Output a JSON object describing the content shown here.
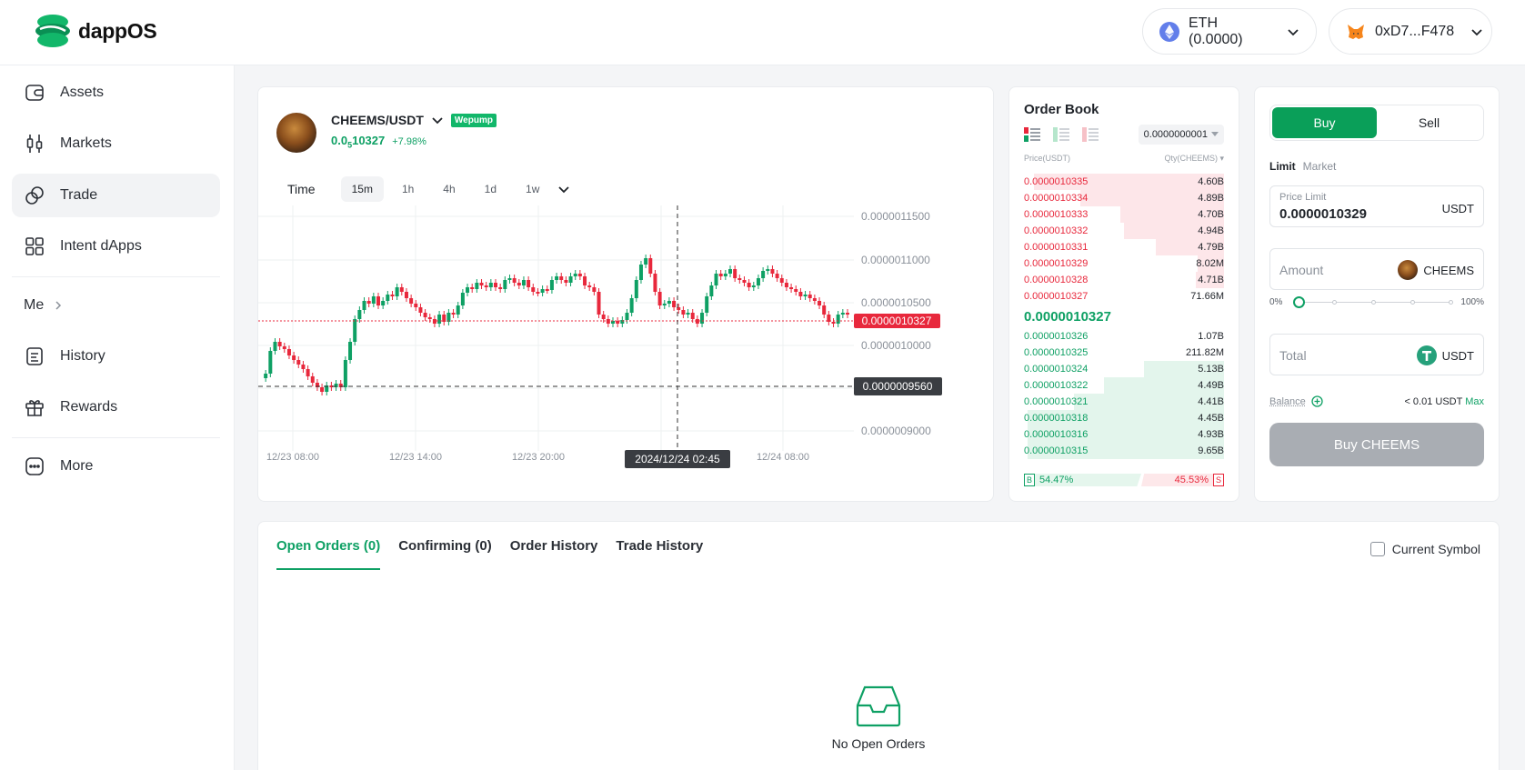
{
  "header": {
    "brand": "dappOS",
    "network_pill": "ETH (0.0000)",
    "wallet_pill": "0xD7...F478"
  },
  "sidebar": {
    "items": [
      {
        "label": "Assets",
        "icon": "wallet-icon"
      },
      {
        "label": "Markets",
        "icon": "candles-icon"
      },
      {
        "label": "Trade",
        "icon": "swap-coins-icon"
      },
      {
        "label": "Intent dApps",
        "icon": "grid-icon"
      }
    ],
    "me_label": "Me",
    "items2": [
      {
        "label": "History",
        "icon": "history-doc-icon"
      },
      {
        "label": "Rewards",
        "icon": "gift-icon"
      }
    ],
    "more_label": "More"
  },
  "pair": {
    "name": "CHEEMS/USDT",
    "badge": "Wepump",
    "price_prefix": "0.0",
    "price_sub": "5",
    "price_rest": "10327",
    "change": "+7.98%"
  },
  "timeframes": [
    "Time",
    "15m",
    "1h",
    "4h",
    "1d",
    "1w"
  ],
  "active_timeframe": "15m",
  "chart_data": {
    "type": "candlestick",
    "y_ticks": [
      "0.0000011500",
      "0.0000011000",
      "0.0000010500",
      "0.0000010000",
      "0.0000009000"
    ],
    "x_ticks": [
      "12/23 08:00",
      "12/23 14:00",
      "12/23 20:00",
      "12/24 08:00"
    ],
    "last_price_label": "0.0000010327",
    "crosshair_price_label": "0.0000009560",
    "crosshair_time_label": "2024/12/24 02:45",
    "colors": {
      "up": "#0ea064",
      "down": "#e8283c"
    }
  },
  "orderbook": {
    "title": "Order Book",
    "precision": "0.0000000001",
    "col_price": "Price(USDT)",
    "col_qty": "Qty(CHEEMS)",
    "asks": [
      {
        "price": "0.0000010335",
        "qty": "4.60B",
        "depth": 0.95
      },
      {
        "price": "0.0000010334",
        "qty": "4.89B",
        "depth": 0.72
      },
      {
        "price": "0.0000010333",
        "qty": "4.70B",
        "depth": 0.52
      },
      {
        "price": "0.0000010332",
        "qty": "4.94B",
        "depth": 0.5
      },
      {
        "price": "0.0000010331",
        "qty": "4.79B",
        "depth": 0.34
      },
      {
        "price": "0.0000010329",
        "qty": "8.02M",
        "depth": 0.13
      },
      {
        "price": "0.0000010328",
        "qty": "4.71B",
        "depth": 0.14
      },
      {
        "price": "0.0000010327",
        "qty": "71.66M",
        "depth": 0.0
      }
    ],
    "mid_price": "0.0000010327",
    "bids": [
      {
        "price": "0.0000010326",
        "qty": "1.07B",
        "depth": 0.0
      },
      {
        "price": "0.0000010325",
        "qty": "211.82M",
        "depth": 0.0
      },
      {
        "price": "0.0000010324",
        "qty": "5.13B",
        "depth": 0.4
      },
      {
        "price": "0.0000010322",
        "qty": "4.49B",
        "depth": 0.6
      },
      {
        "price": "0.0000010321",
        "qty": "4.41B",
        "depth": 0.75
      },
      {
        "price": "0.0000010318",
        "qty": "4.45B",
        "depth": 0.98
      },
      {
        "price": "0.0000010316",
        "qty": "4.93B",
        "depth": 0.98
      },
      {
        "price": "0.0000010315",
        "qty": "9.65B",
        "depth": 0.98
      }
    ],
    "buy_label": "B",
    "buy_ratio": "54.47%",
    "sell_ratio": "45.53%",
    "sell_label": "S"
  },
  "trade": {
    "buy_tab": "Buy",
    "sell_tab": "Sell",
    "limit_label": "Limit",
    "market_label": "Market",
    "price_limit_label": "Price Limit",
    "price_limit_value": "0.0000010329",
    "price_unit": "USDT",
    "amount_placeholder": "Amount",
    "amount_unit": "CHEEMS",
    "slider_min": "0%",
    "slider_max": "100%",
    "total_placeholder": "Total",
    "total_unit": "USDT",
    "balance_label": "Balance",
    "balance_value": "< 0.01 USDT",
    "max_label": "Max",
    "submit_label": "Buy CHEEMS"
  },
  "orders": {
    "tabs": [
      "Open Orders (0)",
      "Confirming (0)",
      "Order History",
      "Trade History"
    ],
    "current_symbol_label": "Current Symbol",
    "empty_text": "No Open Orders"
  }
}
